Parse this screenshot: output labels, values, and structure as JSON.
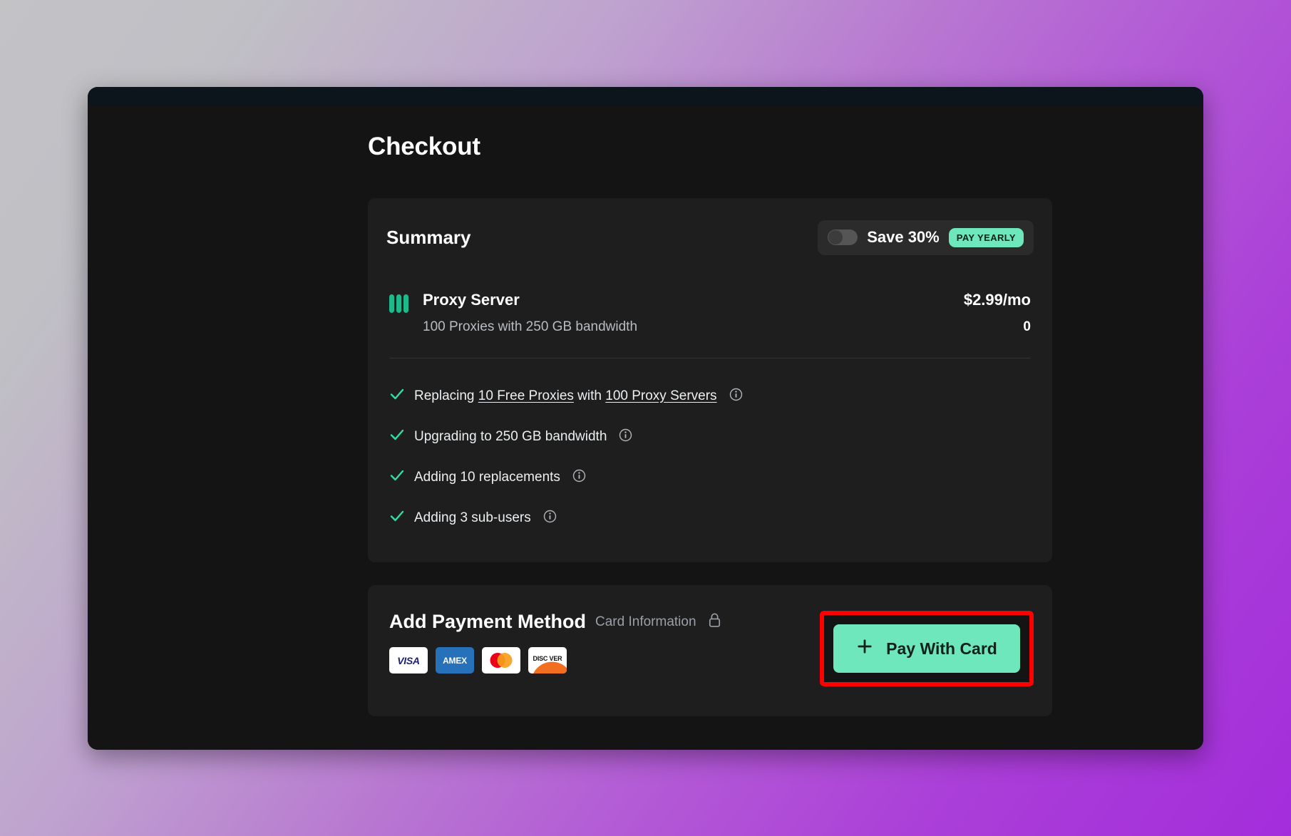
{
  "page": {
    "title": "Checkout"
  },
  "summary": {
    "title": "Summary",
    "billing": {
      "toggle_name": "billing-period-toggle",
      "toggle_on": false,
      "save_label": "Save 30%",
      "badge_label": "PAY YEARLY"
    },
    "product": {
      "icon": "proxy-bars-icon",
      "name": "Proxy Server",
      "description": "100 Proxies with 250 GB bandwidth",
      "price": "$2.99/mo",
      "quantity": "0"
    },
    "features": [
      {
        "check_icon": "check-icon",
        "info_icon": "info-icon",
        "prefix": "Replacing ",
        "link1": "10 Free Proxies",
        "middle": " with ",
        "link2": "100 Proxy Servers",
        "suffix": ""
      },
      {
        "check_icon": "check-icon",
        "info_icon": "info-icon",
        "text": "Upgrading to 250 GB bandwidth"
      },
      {
        "check_icon": "check-icon",
        "info_icon": "info-icon",
        "text": "Adding 10 replacements"
      },
      {
        "check_icon": "check-icon",
        "info_icon": "info-icon",
        "text": "Adding 3 sub-users"
      }
    ]
  },
  "payment": {
    "title": "Add Payment Method",
    "card_information_label": "Card Information",
    "lock_icon": "lock-icon",
    "brands": [
      {
        "name": "visa",
        "label": "VISA"
      },
      {
        "name": "amex",
        "label": "AMEX"
      },
      {
        "name": "mastercard",
        "label": ""
      },
      {
        "name": "discover",
        "label": "DISC VER"
      }
    ],
    "pay_button": {
      "label": "Pay With Card",
      "plus_icon": "plus-icon"
    }
  },
  "colors": {
    "accent_teal": "#6ee7bc",
    "highlight_red": "#ff0000",
    "panel_bg": "#1e1e1e",
    "card_bg": "#141414",
    "titlebar_bg": "#0b151b"
  }
}
